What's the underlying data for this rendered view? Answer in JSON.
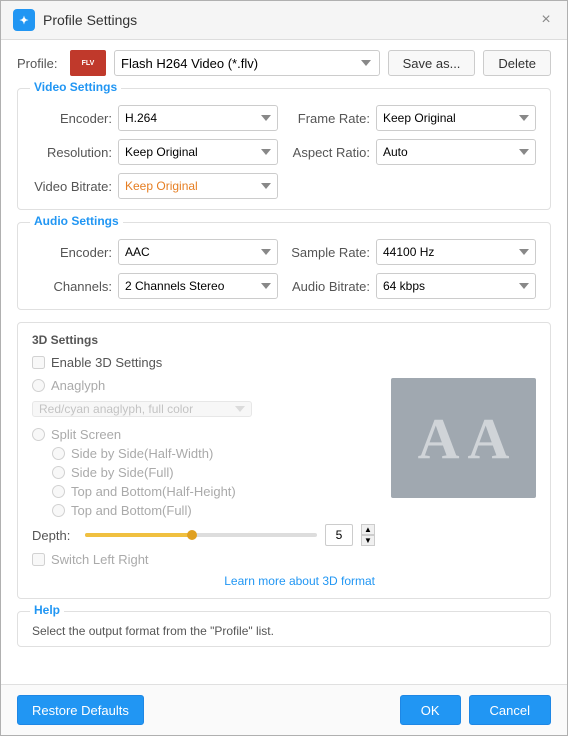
{
  "window": {
    "title": "Profile Settings",
    "close_label": "×"
  },
  "profile": {
    "label": "Profile:",
    "value": "Flash H264 Video (*.flv)",
    "icon_label": "FLV",
    "save_as_label": "Save as...",
    "delete_label": "Delete"
  },
  "video_settings": {
    "section_title": "Video Settings",
    "encoder_label": "Encoder:",
    "encoder_value": "H.264",
    "frame_rate_label": "Frame Rate:",
    "frame_rate_value": "Keep Original",
    "resolution_label": "Resolution:",
    "resolution_value": "Keep Original",
    "aspect_ratio_label": "Aspect Ratio:",
    "aspect_ratio_value": "Auto",
    "video_bitrate_label": "Video Bitrate:",
    "video_bitrate_value": "Keep Original"
  },
  "audio_settings": {
    "section_title": "Audio Settings",
    "encoder_label": "Encoder:",
    "encoder_value": "AAC",
    "sample_rate_label": "Sample Rate:",
    "sample_rate_value": "44100 Hz",
    "channels_label": "Channels:",
    "channels_value": "2 Channels Stereo",
    "audio_bitrate_label": "Audio Bitrate:",
    "audio_bitrate_value": "64 kbps"
  },
  "settings_3d": {
    "section_title": "3D Settings",
    "enable_label": "Enable 3D Settings",
    "anaglyph_label": "Anaglyph",
    "anaglyph_option": "Red/cyan anaglyph, full color",
    "split_screen_label": "Split Screen",
    "sub_options": [
      "Side by Side(Half-Width)",
      "Side by Side(Full)",
      "Top and Bottom(Half-Height)",
      "Top and Bottom(Full)"
    ],
    "depth_label": "Depth:",
    "depth_value": "5",
    "switch_lr_label": "Switch Left Right",
    "learn_more_label": "Learn more about 3D format",
    "preview_letter1": "A",
    "preview_letter2": "A"
  },
  "help": {
    "section_title": "Help",
    "text": "Select the output format from the \"Profile\" list."
  },
  "footer": {
    "restore_label": "Restore Defaults",
    "ok_label": "OK",
    "cancel_label": "Cancel"
  }
}
